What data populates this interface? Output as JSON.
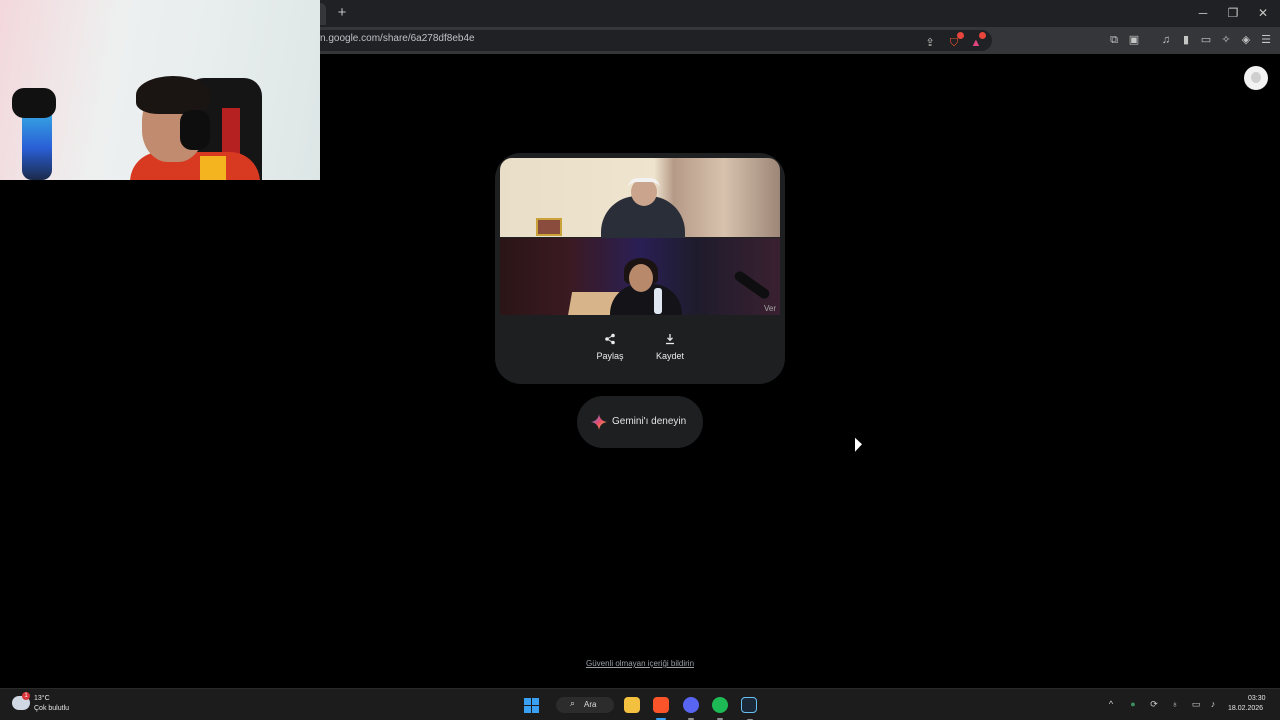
{
  "browser": {
    "url": "n.google.com/share/6a278df8eb4e",
    "new_tab_symbol": "+",
    "window_controls": {
      "minimize": "─",
      "maximize": "❐",
      "close": "✕"
    }
  },
  "share_card": {
    "watermark": "Ver",
    "actions": [
      {
        "label": "Paylaş",
        "icon": "share-icon"
      },
      {
        "label": "Kaydet",
        "icon": "download-icon"
      }
    ]
  },
  "gemini_button": {
    "label": "Gemini'ı deneyin",
    "icon": "gemini-sparkle-icon"
  },
  "report_link": "Güvenli olmayan içeriği bildirin",
  "taskbar": {
    "weather": {
      "temp": "13°C",
      "condition": "Çok bulutlu",
      "badge": "1"
    },
    "search_label": "Ara",
    "clock": {
      "time": "03:30",
      "date": "18.02.2026"
    }
  },
  "colors": {
    "background": "#000000",
    "card": "#1e1f20",
    "accent_blue": "#3aa0f4",
    "brave_orange": "#fb542b",
    "spotify_green": "#1db954"
  }
}
